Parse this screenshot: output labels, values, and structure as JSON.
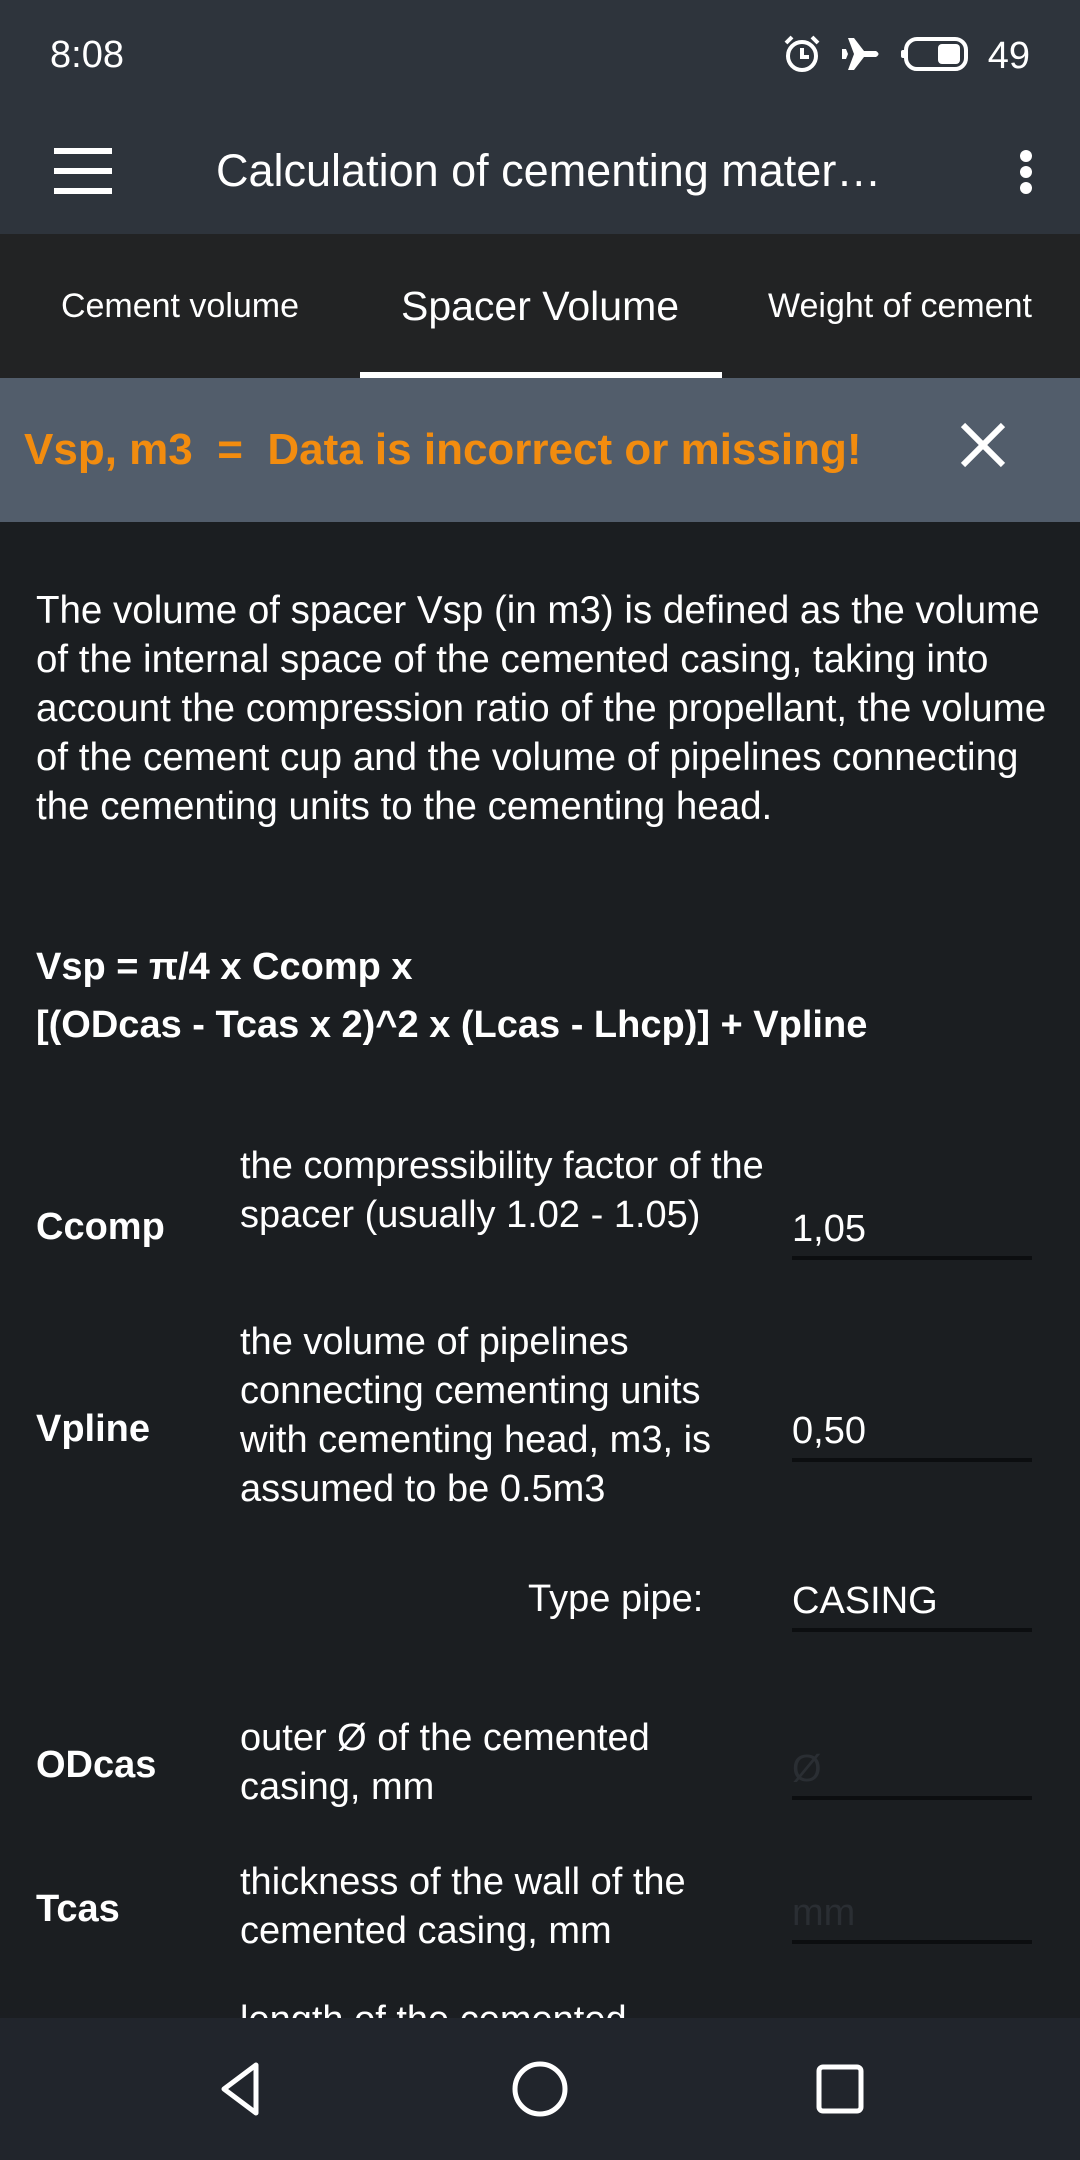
{
  "status_bar": {
    "time": "8:08",
    "icons": [
      "alarm-icon",
      "airplane-mode-icon",
      "battery-icon"
    ],
    "battery_level": "49"
  },
  "app_bar": {
    "menu_icon": "hamburger-menu-icon",
    "title": "Calculation of cementing mater…",
    "overflow_icon": "more-vert-icon"
  },
  "tabs": [
    {
      "label": "Cement volume",
      "selected": false
    },
    {
      "label": "Spacer Volume",
      "selected": true
    },
    {
      "label": "Weight of cement",
      "selected": false
    }
  ],
  "result_banner": {
    "text": "Vsp, m3  =  Data is incorrect or missing!",
    "text_color": "#f28c0f",
    "background": "#525d6b",
    "close_icon": "close-icon"
  },
  "description": "The volume of spacer Vsp (in m3) is defined as the volume of the internal space of the cemented casing, taking into account the compression ratio of the propellant, the volume of the cement cup and the volume of pipelines connecting the cementing units to the cementing head.",
  "formula": {
    "line1": "Vsp = π/4 x Ccomp x",
    "line2": "[(ODcas - Tcas x 2)^2 x (Lcas - Lhcp)] + Vpline"
  },
  "params": [
    {
      "name": "Ccomp",
      "description": "the compressibility factor of the spacer (usually 1.02 - 1.05)",
      "value": "1,05",
      "placeholder": ""
    },
    {
      "name": "Vpline",
      "description": "the volume of pipelines connecting cementing units with cementing head, m3, is assumed to be 0.5m3",
      "value": "0,50",
      "placeholder": ""
    },
    {
      "name": "ODcas",
      "description": "outer Ø of the cemented casing, mm",
      "value": "",
      "placeholder": "Ø"
    },
    {
      "name": "Tcas",
      "description": "thickness of the wall of the cemented casing, mm",
      "value": "",
      "placeholder": "mm"
    },
    {
      "name": "",
      "description": "length of the cemented",
      "value": "",
      "placeholder": ""
    }
  ],
  "type_pipe": {
    "label": "Type pipe:",
    "value": "CASING"
  },
  "nav_bar": {
    "buttons": [
      "back-icon",
      "home-icon",
      "recents-icon"
    ]
  }
}
